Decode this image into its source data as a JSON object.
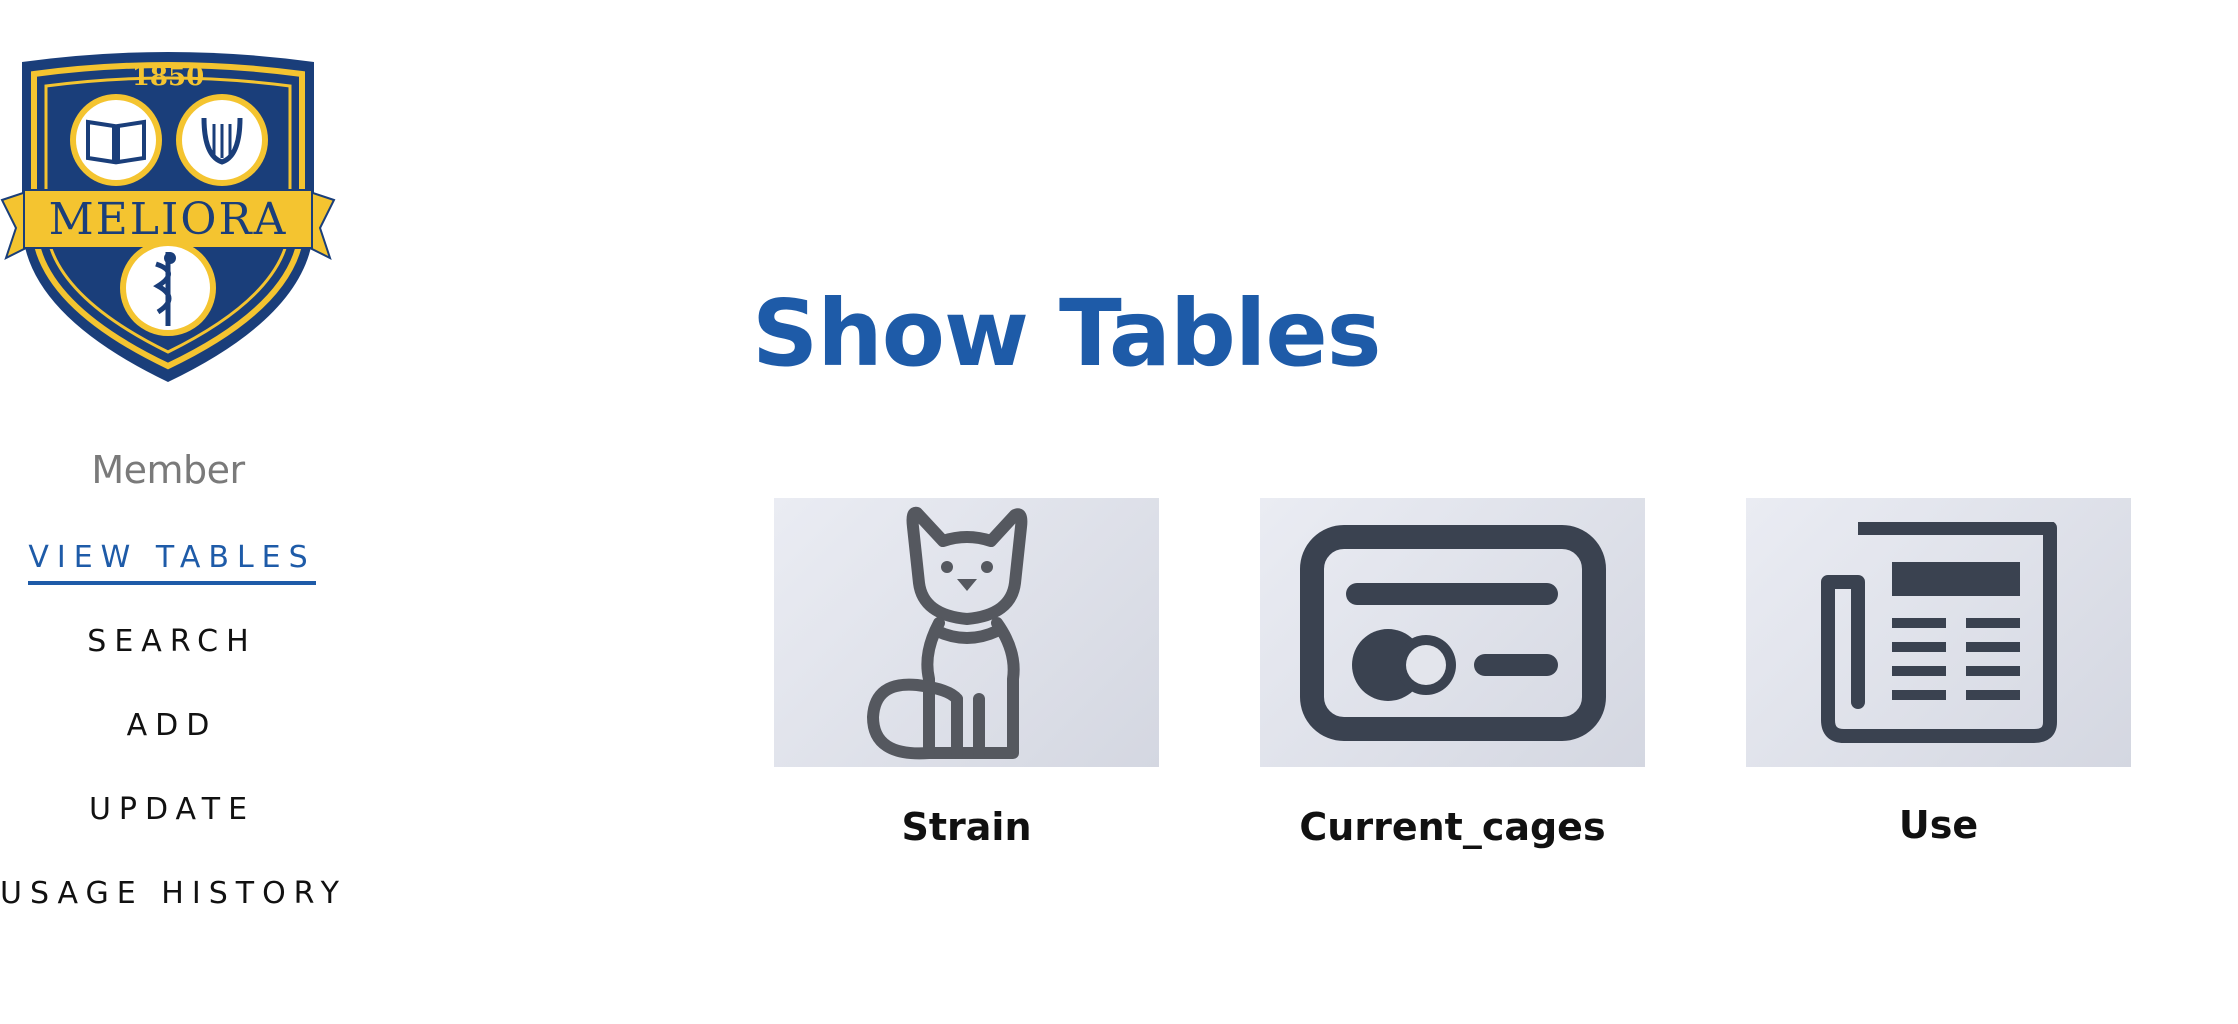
{
  "logo": {
    "year": "1850",
    "motto": "MELIORA",
    "colors": {
      "navy": "#1a3e7a",
      "gold": "#f4c430",
      "white": "#ffffff"
    }
  },
  "sidebar": {
    "role": "Member",
    "nav": [
      {
        "label": "VIEW TABLES",
        "active": true
      },
      {
        "label": "SEARCH",
        "active": false
      },
      {
        "label": "ADD",
        "active": false
      },
      {
        "label": "UPDATE",
        "active": false
      },
      {
        "label": "USAGE HISTORY",
        "active": false
      }
    ],
    "accent_color": "#1e5ba8"
  },
  "main": {
    "title": "Show Tables",
    "cards": [
      {
        "label": "Strain",
        "icon": "cat-icon"
      },
      {
        "label": "Current_cages",
        "icon": "id-card-icon"
      },
      {
        "label": "Use",
        "icon": "newspaper-icon"
      }
    ]
  }
}
